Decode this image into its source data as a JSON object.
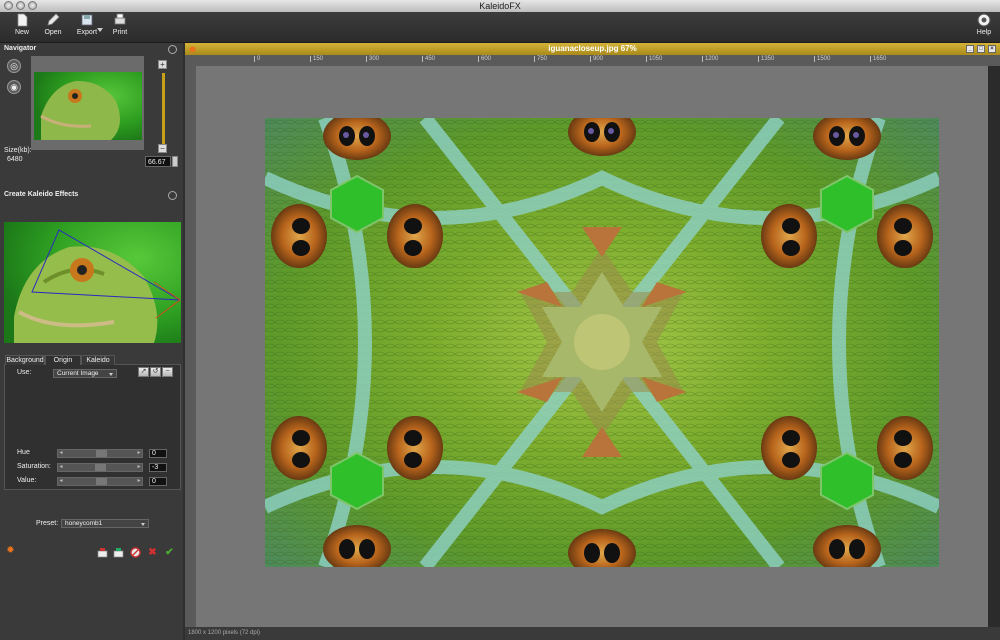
{
  "app": {
    "title": "KaleidoFX"
  },
  "toolbar": {
    "new_label": "New",
    "open_label": "Open",
    "export_label": "Export",
    "print_label": "Print",
    "help_label": "Help"
  },
  "navigator": {
    "title": "Navigator",
    "size_label": "Size(kb):",
    "size_value": "6480",
    "zoom_value": "66.67"
  },
  "kaleido": {
    "title": "Create Kaleido Effects",
    "tabs": [
      "Background",
      "Origin",
      "Kaleido"
    ],
    "active_tab": "Origin",
    "use_label": "Use:",
    "use_value": "Current Image",
    "hue_label": "Hue",
    "hue_value": "0",
    "saturation_label": "Saturation:",
    "saturation_value": "-3",
    "value_label": "Value:",
    "value_value": "0",
    "preset_label": "Preset:",
    "preset_value": "honeycomb1"
  },
  "document": {
    "title": "iguanacloseup.jpg 67%",
    "status": "1800 x 1200 pixels (72 dpi)",
    "ruler_ticks": [
      "0",
      "150",
      "300",
      "450",
      "600",
      "750",
      "900",
      "1050",
      "1200",
      "1350",
      "1500",
      "1650"
    ]
  },
  "colors": {
    "doc_titlebar": "#c6a117",
    "panel_bg": "#3a3a3a",
    "canvas_bg": "#767676",
    "ok_green": "#4caf32",
    "cancel_red": "#d33030"
  }
}
